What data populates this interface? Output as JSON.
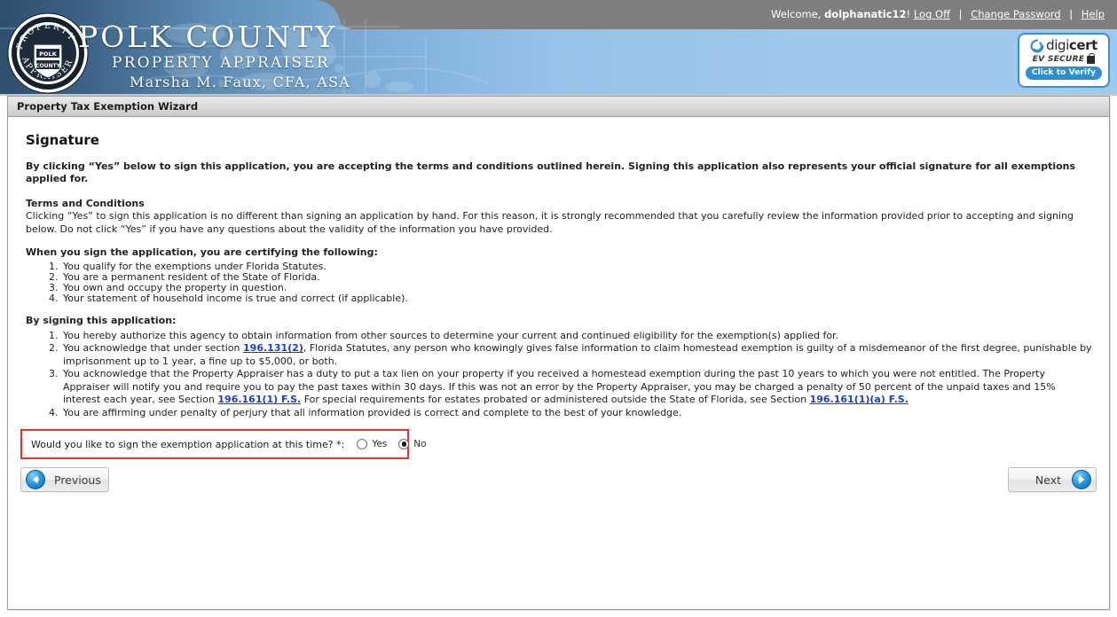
{
  "header": {
    "welcome_prefix": "Welcome, ",
    "username": "dolphanatic12",
    "welcome_suffix": "!",
    "log_off_label": "Log Off",
    "separator": "|",
    "change_password_label": "Change Password",
    "help_label": "Help",
    "org_line1": "POLK COUNTY",
    "org_line2": "PROPERTY APPRAISER",
    "org_line3": "Marsha M. Faux, CFA, ASA",
    "seal_text_top": "PROPERTY",
    "seal_text_bottom": "APPRAISER",
    "seal_shield_line1": "POLK",
    "seal_shield_line2": "COUNTY",
    "digicert": {
      "brand_part1": "digi",
      "brand_part2": "cert",
      "tagline": "EV SECURE",
      "button_label": "Click to Verify"
    }
  },
  "wizard": {
    "titlebar": "Property Tax Exemption Wizard",
    "page_heading": "Signature",
    "bold_intro": "By clicking “Yes” below to sign this application, you are accepting the terms and conditions outlined herein. Signing this application also represents your official signature for all exemptions applied for.",
    "terms_heading": "Terms and Conditions",
    "terms_body": "Clicking “Yes” to sign this application is no different than signing an application by hand. For this reason, it is strongly recommended that you carefully review the information provided prior to accepting and signing below. Do not click “Yes” if you have any questions about the validity of the information you have provided.",
    "certify_heading": "When you sign the application, you are certifying the following:",
    "certify_items": [
      "You qualify for the exemptions under Florida Statutes.",
      "You are a permanent resident of the State of Florida.",
      "You own and occupy the property in question.",
      "Your statement of household income is true and correct (if applicable)."
    ],
    "signing_heading": "By signing this application:",
    "signing_items": {
      "item1": "You hereby authorize this agency to obtain information from other sources to determine your current and continued eligibility for the exemption(s) applied for.",
      "item2_pre": "You acknowledge that under section ",
      "item2_link": "196.131(2)",
      "item2_post": ", Florida Statutes, any person who knowingly gives false information to claim homestead exemption is guilty of a misdemeanor of the first degree, punishable by imprisonment up to 1 year, a fine up to $5,000, or both.",
      "item3_pre": "You acknowledge that the Property Appraiser has a duty to put a tax lien on your property if you received a homestead exemption during the past 10 years to which you were not entitled. The Property Appraiser will notify you and require you to pay the past taxes within 30 days. If this was not an error by the Property Appraiser, you may be charged a penalty of 50 percent of the unpaid taxes and 15% interest each year, see Section ",
      "item3_link1": "196.161(1) F.S.",
      "item3_mid": " For special requirements for estates probated or administered outside the State of Florida, see Section ",
      "item3_link2": "196.161(1)(a) F.S.",
      "item3_post": "",
      "item4": "You are affirming under penalty of perjury that all information provided is correct and complete to the best of your knowledge."
    },
    "question": {
      "label": "Would you like to sign the exemption application at this time? *:",
      "option_yes": "Yes",
      "option_no": "No",
      "selected": "No"
    },
    "previous_label": "Previous",
    "next_label": "Next"
  },
  "colors": {
    "highlight_border": "#ee3124",
    "link": "#1a3fd0",
    "banner_dark": "#2e4f6e",
    "banner_light": "#9ec8ec",
    "digicert_blue": "#2d8fd0"
  }
}
